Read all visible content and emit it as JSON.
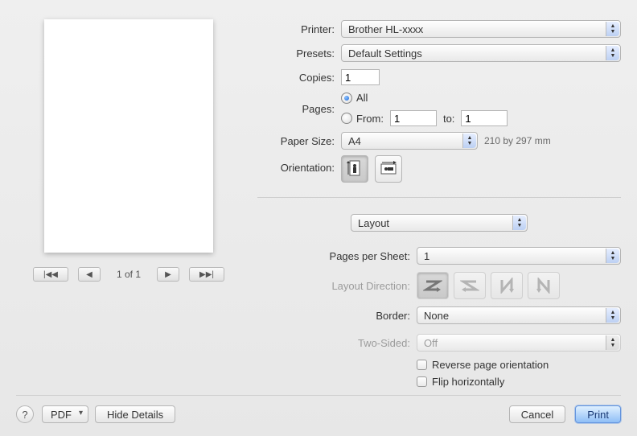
{
  "preview": {
    "pager": {
      "page_label": "1 of 1"
    }
  },
  "form": {
    "printer": {
      "label": "Printer:",
      "value": "Brother HL-xxxx"
    },
    "presets": {
      "label": "Presets:",
      "value": "Default Settings"
    },
    "copies": {
      "label": "Copies:",
      "value": "1"
    },
    "pages": {
      "label": "Pages:",
      "all_label": "All",
      "from_label": "From:",
      "from_value": "1",
      "to_label": "to:",
      "to_value": "1",
      "selected": "all"
    },
    "paper_size": {
      "label": "Paper Size:",
      "value": "A4",
      "dimensions": "210 by 297 mm"
    },
    "orientation": {
      "label": "Orientation:",
      "selected": "portrait"
    }
  },
  "section": {
    "value": "Layout"
  },
  "layout": {
    "pages_per_sheet": {
      "label": "Pages per Sheet:",
      "value": "1"
    },
    "layout_direction": {
      "label": "Layout Direction:",
      "selected": "z1"
    },
    "border": {
      "label": "Border:",
      "value": "None"
    },
    "two_sided": {
      "label": "Two-Sided:",
      "value": "Off"
    },
    "reverse_label": "Reverse page orientation",
    "flip_label": "Flip horizontally",
    "reverse_checked": false,
    "flip_checked": false
  },
  "bottom": {
    "pdf_label": "PDF",
    "hide_details_label": "Hide Details",
    "cancel_label": "Cancel",
    "print_label": "Print"
  }
}
